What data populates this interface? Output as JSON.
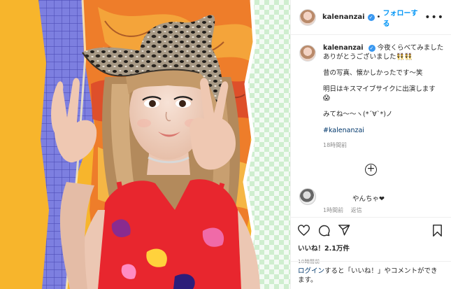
{
  "post": {
    "username": "kalenanzai",
    "verified_mark": "✓",
    "separator": "•",
    "follow_label": "フォローする",
    "more_label": "•••"
  },
  "caption": {
    "username": "kalenanzai",
    "line1": "今夜くらべてみました",
    "line2": "ありがとうございました",
    "line2_emoji": "👯👯",
    "line3": "昔の写真、懐かしかったです〜笑",
    "line4": "明日はキスマイブサイクに出演します",
    "line4_emoji": "😱",
    "line5": "みてね〜〜ヽ(*´∀`*)ノ",
    "hashtag": "#kalenanzai",
    "time": "18時間前"
  },
  "load_more_label": "+",
  "reply": {
    "text": "やんちゃ❤",
    "time": "1時間前",
    "reply_label": "返信"
  },
  "likes": "いいね！2.1万件",
  "post_time": "18時間前",
  "login_prompt": {
    "link": "ログイン",
    "text": "すると「いいね！」やコメントができます。"
  },
  "icons": {
    "like": "heart-icon",
    "comment": "comment-icon",
    "share": "share-icon",
    "save": "bookmark-icon",
    "verified": "verified-badge-icon",
    "more": "more-options-icon",
    "add": "plus-circle-icon"
  },
  "colors": {
    "follow": "#0095f6",
    "verified": "#3897f0",
    "hashtag": "#00376b",
    "meta": "#8e8e8e",
    "photo_bg": "#f7b52c",
    "dress": "#e8262e"
  }
}
